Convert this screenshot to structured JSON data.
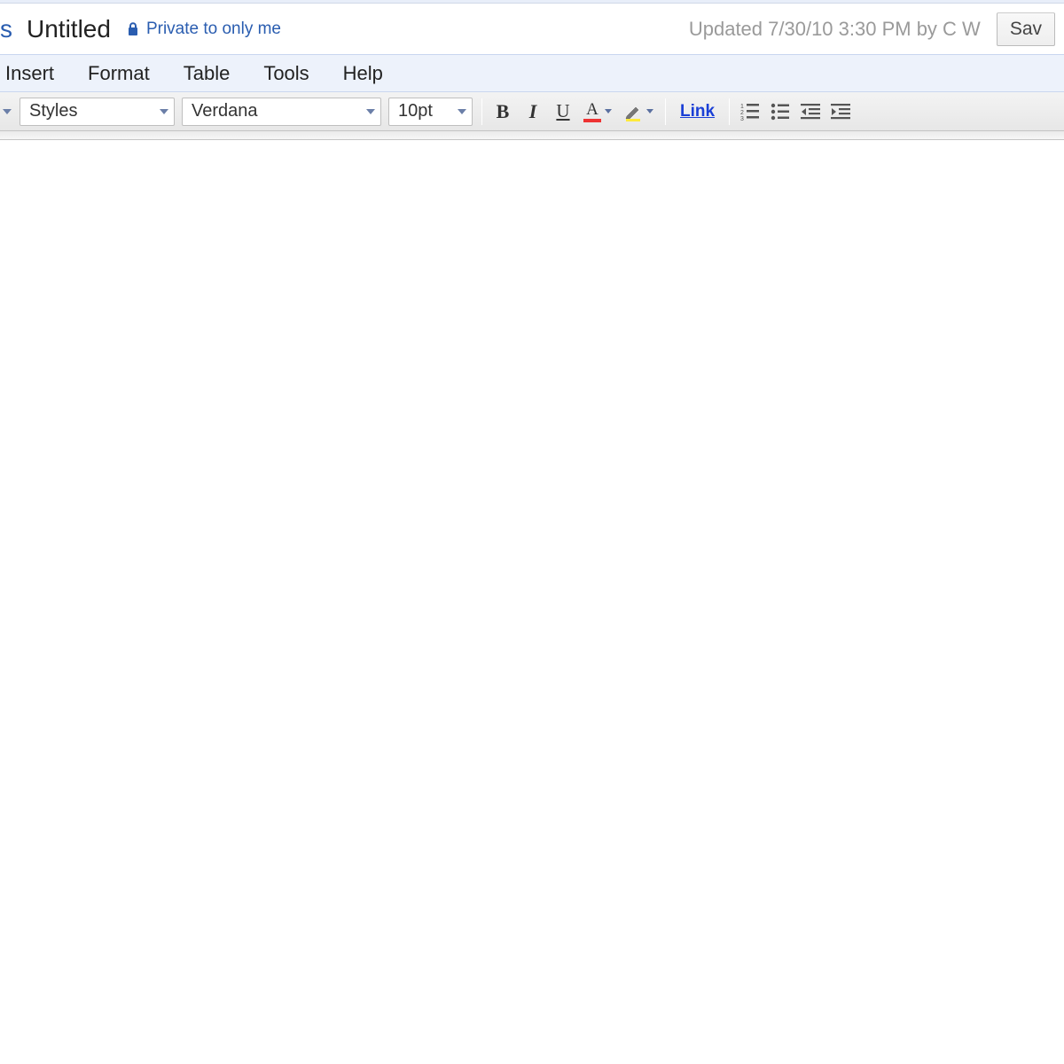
{
  "header": {
    "logo_fragment": "s",
    "title": "Untitled",
    "privacy_label": "Private to only me",
    "updated_text": "Updated 7/30/10 3:30 PM by C W",
    "save_label": "Sav"
  },
  "menu": {
    "items": [
      "Insert",
      "Format",
      "Table",
      "Tools",
      "Help"
    ]
  },
  "toolbar": {
    "styles_label": "Styles",
    "font_label": "Verdana",
    "size_label": "10pt",
    "bold": "B",
    "italic": "I",
    "underline": "U",
    "text_color_letter": "A",
    "link_label": "Link"
  }
}
